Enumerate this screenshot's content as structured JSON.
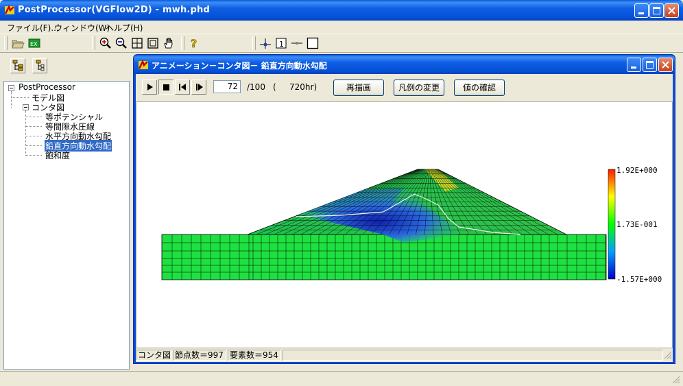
{
  "window": {
    "title": "PostProcessor(VGFlow2D) - mwh.phd"
  },
  "menubar": {
    "items": [
      "ファイル(F)...",
      "ウィンドウ(W)",
      "ヘルプ(H)"
    ]
  },
  "tree": {
    "root": "PostProcessor",
    "items": [
      {
        "label": "モデル図"
      },
      {
        "label": "コンタ図"
      },
      {
        "label": "等ポテンシャル"
      },
      {
        "label": "等間隙水圧線"
      },
      {
        "label": "水平方向動水勾配"
      },
      {
        "label": "鉛直方向動水勾配",
        "selected": true
      },
      {
        "label": "飽和度"
      }
    ]
  },
  "child": {
    "title": "アニメーション－コンタ図－ 鉛直方向動水勾配",
    "frame_value": "72",
    "frame_total": "/100",
    "time_open": "(",
    "time_text": "720hr)",
    "buttons": {
      "redraw": "再描画",
      "legend": "凡例の変更",
      "values": "値の確認"
    },
    "legend": {
      "max": "1.92E+000",
      "mid": "1.73E-001",
      "min": "-1.57E+000",
      "colors": [
        "#ff1a00",
        "#ffff00",
        "#00ff00",
        "#0000c8"
      ]
    },
    "status": {
      "mode": "コンタ図",
      "nodes": "節点数＝997",
      "elements": "要素数＝954"
    }
  },
  "colors": {
    "titlebar": "#0451d6",
    "selection": "#316ac5",
    "contour_base": "#20d040"
  }
}
